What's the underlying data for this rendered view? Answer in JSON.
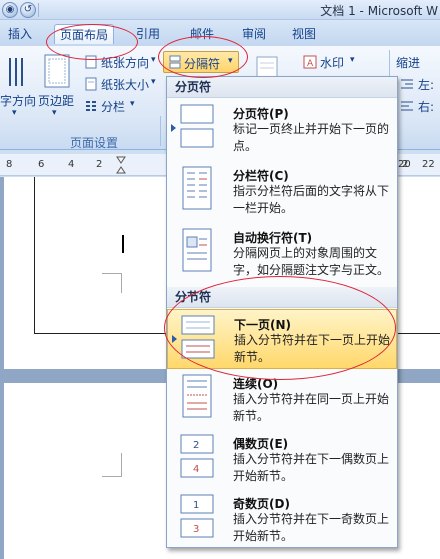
{
  "window": {
    "title": "文档 1 - Microsoft W",
    "office_button_icon": "office-logo-icon",
    "undo_icon": "undo-icon"
  },
  "tabs": [
    {
      "label": "插入"
    },
    {
      "label": "页面布局",
      "active": true
    },
    {
      "label": "引用"
    },
    {
      "label": "邮件"
    },
    {
      "label": "审阅"
    },
    {
      "label": "视图"
    }
  ],
  "ribbon": {
    "text_direction": "字方向",
    "margins": "页边距",
    "orientation": "纸张方向",
    "size": "纸张大小",
    "columns": "分栏",
    "breaks": "分隔符",
    "watermark": "水印",
    "indent": "缩进",
    "left": "左:",
    "right": "右:",
    "group_page_setup": "页面设置"
  },
  "ruler": {
    "numbers": [
      "8",
      "6",
      "4",
      "2",
      "2",
      "20",
      "22"
    ]
  },
  "menu": {
    "section_page_breaks": "分页符",
    "section_section_breaks": "分节符",
    "items": [
      {
        "title": "分页符(P)",
        "desc": "标记一页终止并开始下一页的点。",
        "icon": "page-break-icon"
      },
      {
        "title": "分栏符(C)",
        "desc": "指示分栏符后面的文字将从下一栏开始。",
        "icon": "column-break-icon"
      },
      {
        "title": "自动换行符(T)",
        "desc": "分隔网页上的对象周围的文字，如分隔题注文字与正文。",
        "icon": "text-wrapping-break-icon"
      },
      {
        "title": "下一页(N)",
        "desc": "插入分节符并在下一页上开始新节。",
        "icon": "next-page-break-icon",
        "highlighted": true
      },
      {
        "title": "连续(O)",
        "desc": "插入分节符并在同一页上开始新节。",
        "icon": "continuous-break-icon"
      },
      {
        "title": "偶数页(E)",
        "desc": "插入分节符并在下一偶数页上开始新节。",
        "icon": "even-page-break-icon"
      },
      {
        "title": "奇数页(D)",
        "desc": "插入分节符并在下一奇数页上开始新节。",
        "icon": "odd-page-break-icon"
      }
    ]
  },
  "colors": {
    "accent_text": "#15428b",
    "highlight": "#ffd86b",
    "annotation_red": "#e0233a"
  }
}
